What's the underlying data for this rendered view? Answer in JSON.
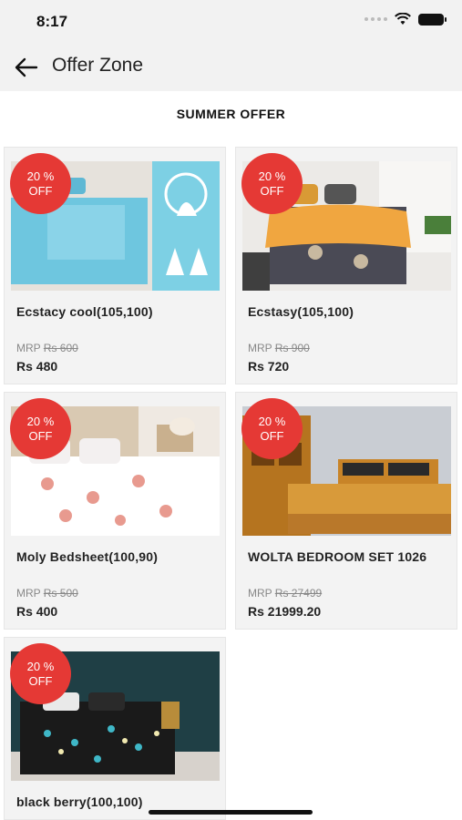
{
  "status": {
    "time": "8:17"
  },
  "header": {
    "title": "Offer Zone"
  },
  "section": {
    "title": "SUMMER OFFER"
  },
  "colors": {
    "accent": "#e53935",
    "background": "#f3f3f3"
  },
  "products": [
    {
      "badge_line1": "20 %",
      "badge_line2": "OFF",
      "name": "Ecstacy cool(105,100)",
      "mrp_label": "MRP",
      "mrp": "Rs 600",
      "price": "Rs 480"
    },
    {
      "badge_line1": "20 %",
      "badge_line2": "OFF",
      "name": "Ecstasy(105,100)",
      "mrp_label": "MRP",
      "mrp": "Rs 900",
      "price": "Rs 720"
    },
    {
      "badge_line1": "20 %",
      "badge_line2": "OFF",
      "name": "Moly Bedsheet(100,90)",
      "mrp_label": "MRP",
      "mrp": "Rs 500",
      "price": "Rs 400"
    },
    {
      "badge_line1": "20 %",
      "badge_line2": "OFF",
      "name": "WOLTA BEDROOM SET 1026",
      "mrp_label": "MRP",
      "mrp": "Rs 27499",
      "price": "Rs 21999.20"
    },
    {
      "badge_line1": "20 %",
      "badge_line2": "OFF",
      "name": "black berry(100,100)",
      "mrp_label": "",
      "mrp": "",
      "price": ""
    }
  ]
}
